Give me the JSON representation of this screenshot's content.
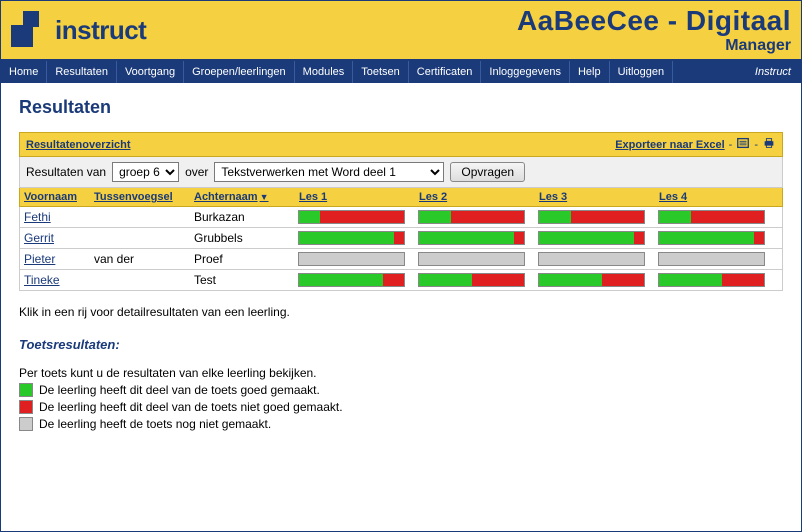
{
  "header": {
    "logo_text": "instruct",
    "app_title": "AaBeeCee - Digitaal",
    "app_sub": "Manager",
    "brand_right": "Instruct"
  },
  "nav": [
    "Home",
    "Resultaten",
    "Voortgang",
    "Groepen/leerlingen",
    "Modules",
    "Toetsen",
    "Certificaten",
    "Inloggegevens",
    "Help",
    "Uitloggen"
  ],
  "page_title": "Resultaten",
  "overview": {
    "label": "Resultatenoverzicht",
    "export_label": "Exporteer naar Excel"
  },
  "filter": {
    "prefix": "Resultaten van",
    "group_selected": "groep 6",
    "mid": "over",
    "module_selected": "Tekstverwerken met Word deel 1",
    "button": "Opvragen"
  },
  "columns": {
    "voornaam": "Voornaam",
    "tussen": "Tussenvoegsel",
    "achternaam": "Achternaam",
    "les1": "Les 1",
    "les2": "Les 2",
    "les3": "Les 3",
    "les4": "Les 4"
  },
  "rows": [
    {
      "voornaam": "Fethi",
      "tussen": "",
      "achternaam": "Burkazan",
      "les": [
        [
          [
            "g",
            20
          ],
          [
            "r",
            80
          ]
        ],
        [
          [
            "g",
            30
          ],
          [
            "r",
            70
          ]
        ],
        [
          [
            "g",
            30
          ],
          [
            "r",
            70
          ]
        ],
        [
          [
            "g",
            30
          ],
          [
            "r",
            70
          ]
        ]
      ]
    },
    {
      "voornaam": "Gerrit",
      "tussen": "",
      "achternaam": "Grubbels",
      "les": [
        [
          [
            "g",
            90
          ],
          [
            "r",
            10
          ]
        ],
        [
          [
            "g",
            90
          ],
          [
            "r",
            10
          ]
        ],
        [
          [
            "g",
            90
          ],
          [
            "r",
            10
          ]
        ],
        [
          [
            "g",
            90
          ],
          [
            "r",
            10
          ]
        ]
      ]
    },
    {
      "voornaam": "Pieter",
      "tussen": "van der",
      "achternaam": "Proef",
      "les": [
        [
          [
            "n",
            100
          ]
        ],
        [
          [
            "n",
            100
          ]
        ],
        [
          [
            "n",
            100
          ]
        ],
        [
          [
            "n",
            100
          ]
        ]
      ]
    },
    {
      "voornaam": "Tineke",
      "tussen": "",
      "achternaam": "Test",
      "les": [
        [
          [
            "g",
            80
          ],
          [
            "r",
            20
          ]
        ],
        [
          [
            "g",
            50
          ],
          [
            "r",
            50
          ]
        ],
        [
          [
            "g",
            60
          ],
          [
            "r",
            40
          ]
        ],
        [
          [
            "g",
            60
          ],
          [
            "r",
            40
          ]
        ]
      ]
    }
  ],
  "hint": "Klik in een rij voor detailresultaten van een leerling.",
  "subhead": "Toetsresultaten:",
  "intro": "Per toets kunt u de resultaten van elke leerling bekijken.",
  "legend": {
    "g": "De leerling heeft dit deel van de toets goed gemaakt.",
    "r": "De leerling heeft dit deel van de toets niet goed gemaakt.",
    "n": "De leerling heeft de toets nog niet gemaakt."
  }
}
